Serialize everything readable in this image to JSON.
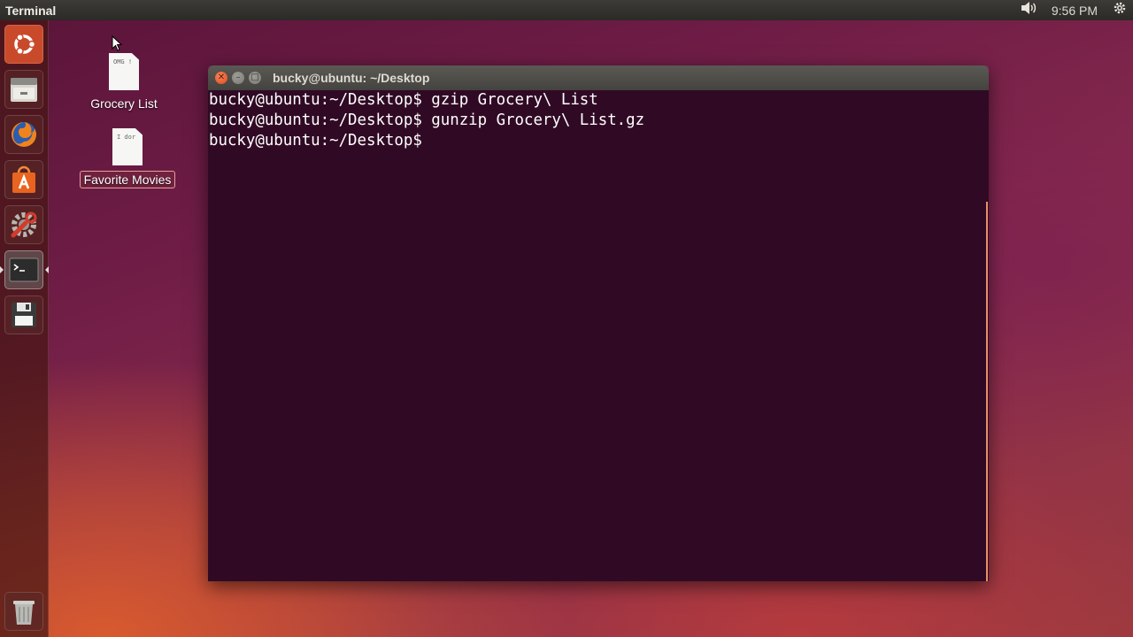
{
  "top_panel": {
    "app_title": "Terminal",
    "clock": "9:56 PM",
    "volume_icon": "volume-icon",
    "settings_icon": "gear-icon"
  },
  "launcher": {
    "items": [
      {
        "name": "dash-home",
        "icon": "ubuntu-logo-icon"
      },
      {
        "name": "files",
        "icon": "file-cabinet-icon"
      },
      {
        "name": "firefox",
        "icon": "firefox-icon"
      },
      {
        "name": "software-center",
        "icon": "shopping-bag-icon"
      },
      {
        "name": "system-settings",
        "icon": "wrench-gear-icon"
      },
      {
        "name": "terminal",
        "icon": "terminal-icon",
        "active": true
      },
      {
        "name": "save",
        "icon": "floppy-disk-icon"
      },
      {
        "name": "trash",
        "icon": "trash-icon"
      }
    ]
  },
  "desktop": {
    "icons": [
      {
        "label": "Grocery List",
        "preview_text": "OMG !"
      },
      {
        "label": "Favorite Movies",
        "preview_text": "I dor",
        "selected": true
      }
    ]
  },
  "terminal": {
    "title": "bucky@ubuntu: ~/Desktop",
    "lines": [
      "bucky@ubuntu:~/Desktop$ gzip Grocery\\ List",
      "bucky@ubuntu:~/Desktop$ gunzip Grocery\\ List.gz",
      "bucky@ubuntu:~/Desktop$ "
    ],
    "colors": {
      "background": "#300a24",
      "text": "#ffffff",
      "scrollbar": "#e8916a"
    }
  }
}
